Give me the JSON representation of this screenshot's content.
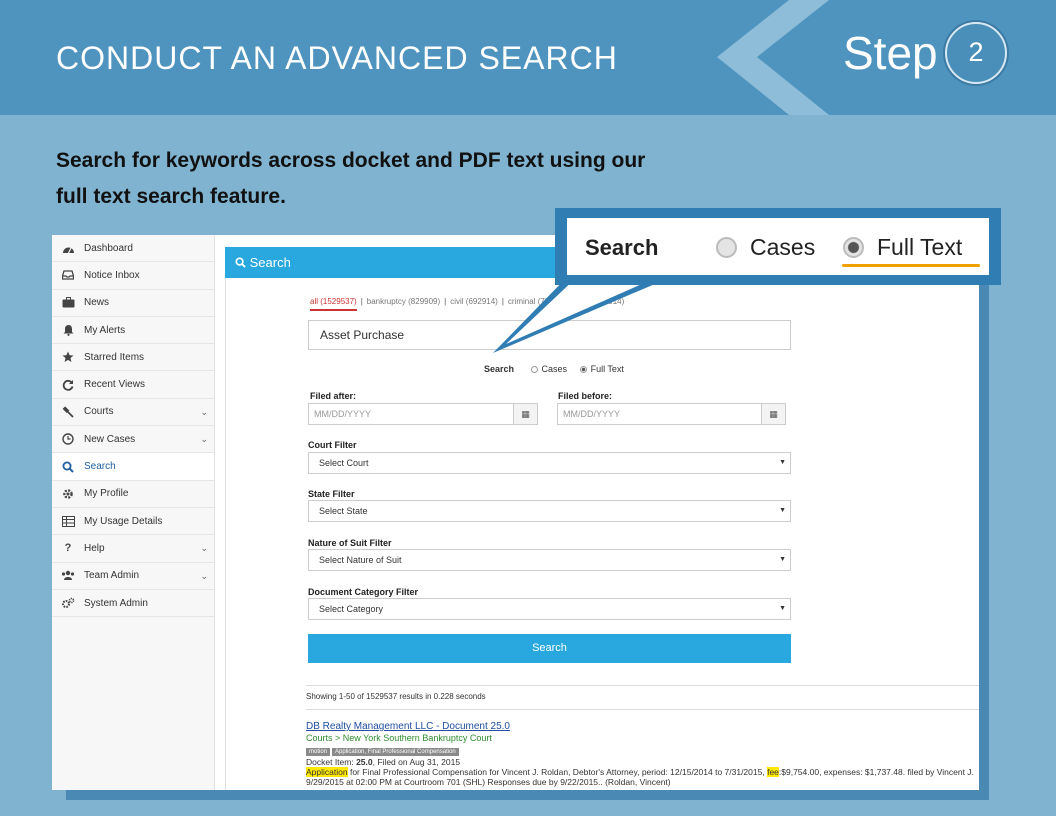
{
  "header": {
    "title": "CONDUCT AN ADVANCED SEARCH",
    "step_word": "Step",
    "step_number": "2"
  },
  "intro": {
    "line1": "Search for keywords across docket and PDF text using our",
    "line2": "full text search feature."
  },
  "sidebar": {
    "items": [
      {
        "label": "Dashboard",
        "icon": "dashboard-icon"
      },
      {
        "label": "Notice Inbox",
        "icon": "inbox-icon"
      },
      {
        "label": "News",
        "icon": "briefcase-icon"
      },
      {
        "label": "My Alerts",
        "icon": "bell-icon"
      },
      {
        "label": "Starred Items",
        "icon": "star-icon"
      },
      {
        "label": "Recent Views",
        "icon": "refresh-icon"
      },
      {
        "label": "Courts",
        "icon": "gavel-icon"
      },
      {
        "label": "New Cases",
        "icon": "clock-icon"
      },
      {
        "label": "Search",
        "icon": "search-icon"
      },
      {
        "label": "My Profile",
        "icon": "gear-icon"
      },
      {
        "label": "My Usage Details",
        "icon": "table-icon"
      },
      {
        "label": "Help",
        "icon": "question-icon"
      },
      {
        "label": "Team Admin",
        "icon": "users-icon"
      },
      {
        "label": "System Admin",
        "icon": "gears-icon"
      }
    ]
  },
  "search_panel": {
    "title": "Search",
    "tabs": [
      {
        "label": "all (1529537)"
      },
      {
        "label": "bankruptcy (829909)"
      },
      {
        "label": "civil (692914)"
      },
      {
        "label": "criminal (728)"
      },
      {
        "label": "appellate (5914)"
      }
    ],
    "query": "Asset Purchase",
    "mode_label": "Search",
    "mode_cases": "Cases",
    "mode_fulltext": "Full Text",
    "filed_after_label": "Filed after:",
    "filed_before_label": "Filed before:",
    "date_placeholder": "MM/DD/YYYY",
    "court_filter_label": "Court Filter",
    "court_filter_value": "Select Court",
    "state_filter_label": "State Filter",
    "state_filter_value": "Select State",
    "nature_filter_label": "Nature of Suit Filter",
    "nature_filter_value": "Select Nature of Suit",
    "category_filter_label": "Document Category Filter",
    "category_filter_value": "Select Category",
    "search_button": "Search",
    "showing": "Showing 1-50 of 1529537 results in 0.228 seconds"
  },
  "result": {
    "title": "DB Realty Management LLC - Document 25.0",
    "court": "Courts > New York Southern Bankruptcy Court",
    "tag1": "motion",
    "tag2": "Application, Final Professional Compensation",
    "docket_prefix": "Docket Item: ",
    "docket_num": "25.0",
    "docket_suffix": ", Filed on Aug 31, 2015",
    "snip_hl1": "Application",
    "snip_text1": " for Final Professional Compensation for Vincent J. Roldan, Debtor's Attorney, period: 12/15/2014 to 7/31/2015, ",
    "snip_hl2": "fee",
    "snip_text2": ":$9,754.00, expenses: $1,737.48. filed by Vincent J.",
    "snip_line2": "9/29/2015 at 02:00 PM at Courtroom 701 (SHL) Responses due by 9/22/2015.. (Roldan, Vincent)"
  },
  "callout": {
    "search_label": "Search",
    "cases_label": "Cases",
    "fulltext_label": "Full Text"
  },
  "colors": {
    "header_blue": "#4f94bf",
    "background_blue": "#7fb3d0",
    "accent_blue": "#29a8df",
    "underline_orange": "#f0a000",
    "highlight_yellow": "#ffe800"
  }
}
